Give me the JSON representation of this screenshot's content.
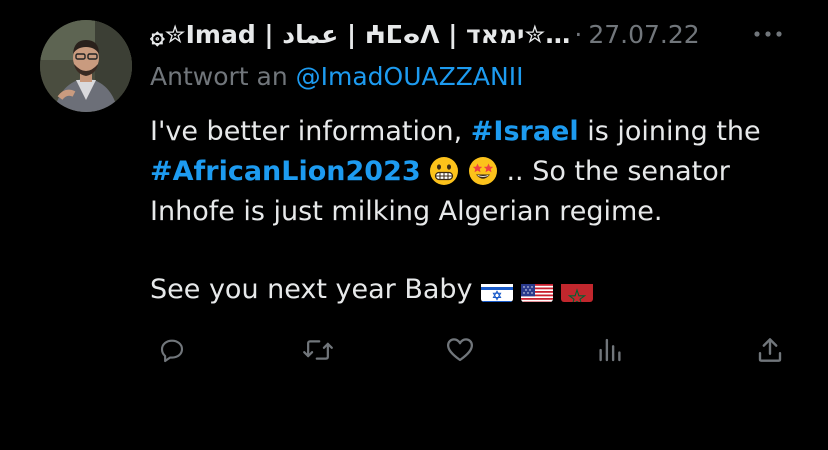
{
  "tweet": {
    "display_name": "۞✮Imad | عماد | ⵄⵎⴰⴷ | ימאד✮…",
    "separator": "·",
    "date": "27.07.22",
    "reply_prefix": "Antwort an",
    "reply_handle": "@ImadOUAZZANII",
    "text": {
      "line1_start": "I've better information, ",
      "hashtag1": "#Israel",
      "line1_end": " is joining the ",
      "hashtag2": "#AfricanLion2023",
      "after_emojis": " .. So the senator Inhofe is just milking Algerian regime.",
      "line2": "See you next year Baby"
    },
    "emojis": [
      "grimacing-face",
      "star-struck"
    ],
    "flags": [
      "israel-flag",
      "usa-flag",
      "morocco-flag"
    ]
  },
  "actions": {
    "icons": [
      "reply-icon",
      "retweet-icon",
      "like-icon",
      "views-icon",
      "share-icon"
    ]
  },
  "colors": {
    "background": "#000000",
    "text": "#e7e9ea",
    "muted": "#71767b",
    "accent": "#1d9bf0"
  }
}
